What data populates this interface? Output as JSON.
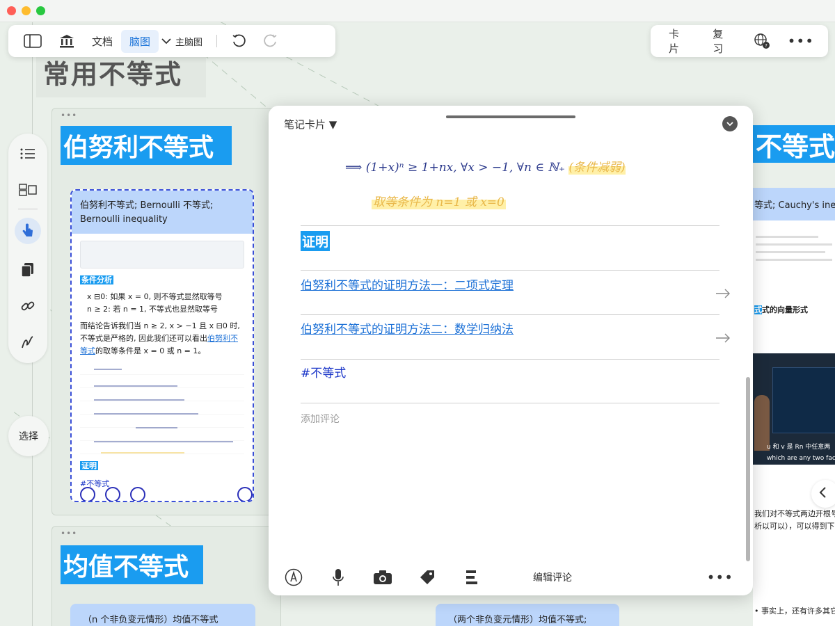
{
  "toolbar": {
    "doc_label": "文档",
    "mindmap_label": "脑图",
    "main_mindmap_label": "主脑图"
  },
  "toolbar_right": {
    "card_label": "卡片",
    "review_label": "复习"
  },
  "sidebar": {
    "select_label": "选择"
  },
  "canvas": {
    "page_title": "常用不等式",
    "group1_heading": "伯努利不等式",
    "group2_heading": "均值不等式",
    "right_heading": "不等式",
    "bottom_chip_left": "（n 个非负变元情形）均值不等式",
    "bottom_chip_right": "（两个非负变元情形）均值不等式;"
  },
  "mini_card": {
    "title": "伯努利不等式; Bernoulli 不等式; Bernoulli inequality",
    "cond_heading": "条件分析",
    "bullet1": "x ⊟0: 如果 x = 0, 则不等式显然取等号",
    "bullet2": "n ≥ 2: 若 n = 1, 不等式也显然取等号",
    "para_a": "而结论告诉我们当 n ≥ 2, x > −1 且 x ⊟0 时, 不等式是严格的, 因此我们还可以看出",
    "para_link": "伯努利不等式",
    "para_b": "的取等条件是 x = 0 或 n = 1。",
    "proof_heading": "证明",
    "tag": "#不等式"
  },
  "peek": {
    "card_title": "等式; Cauchy's ineq",
    "vector_label": "式的向量形式",
    "video_caption_1": "u 和 v 是 Rn 中任意两",
    "video_caption_2": "which are any two facto",
    "text_1": "我们对不等式两边开根号",
    "text_2": "析以可以），可以得到下",
    "bullet": "• 事实上，还有许多其它类型的"
  },
  "modal": {
    "title": "笔记卡片 ▼",
    "formula": "⟹ (1+x)ⁿ ≥ 1+nx, ∀x > −1, ∀n ∈ ℕ₊",
    "formula_note": "(条件减弱)",
    "equality_note": "取等条件为 n=1 或 x=0",
    "proof_heading": "证明",
    "link1": "伯努利不等式的证明方法一：二项式定理",
    "link2": "伯努利不等式的证明方法二：数学归纳法",
    "tag": "#不等式",
    "comment_placeholder": "添加评论",
    "edit_comment_label": "编辑评论"
  }
}
